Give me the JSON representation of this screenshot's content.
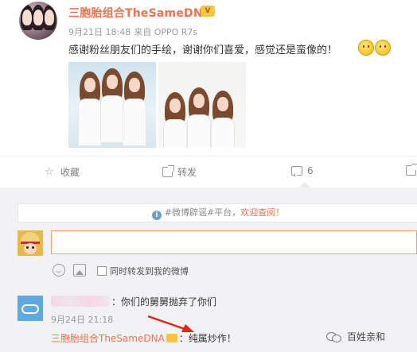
{
  "post": {
    "author": "三胞胎组合TheSameDNA",
    "vip_badge": "V",
    "time": "9月21日 18:48",
    "source": "来自 OPPO R7s",
    "text": "感谢粉丝朋友们的手绘，谢谢你们喜爱，感觉还是蛮像的！"
  },
  "actions": {
    "favorite": "收藏",
    "forward": "转发",
    "comment_count": "6"
  },
  "notice": {
    "prefix": "#微博辟谣#平台，",
    "link": "欢迎查阅！"
  },
  "composer": {
    "sync_label": "同时转发到我的微博"
  },
  "comment": {
    "text": "：你们的舅舅抛弃了你们",
    "time": "9月24日 21:18"
  },
  "reply": {
    "author": "三胞胎组合TheSameDNA",
    "text": "：纯属炒作！"
  },
  "watermark": {
    "text": "百姓亲和"
  },
  "colors": {
    "accent": "#eb7350",
    "vip": "#f6c545",
    "arrow": "#e0251b"
  }
}
